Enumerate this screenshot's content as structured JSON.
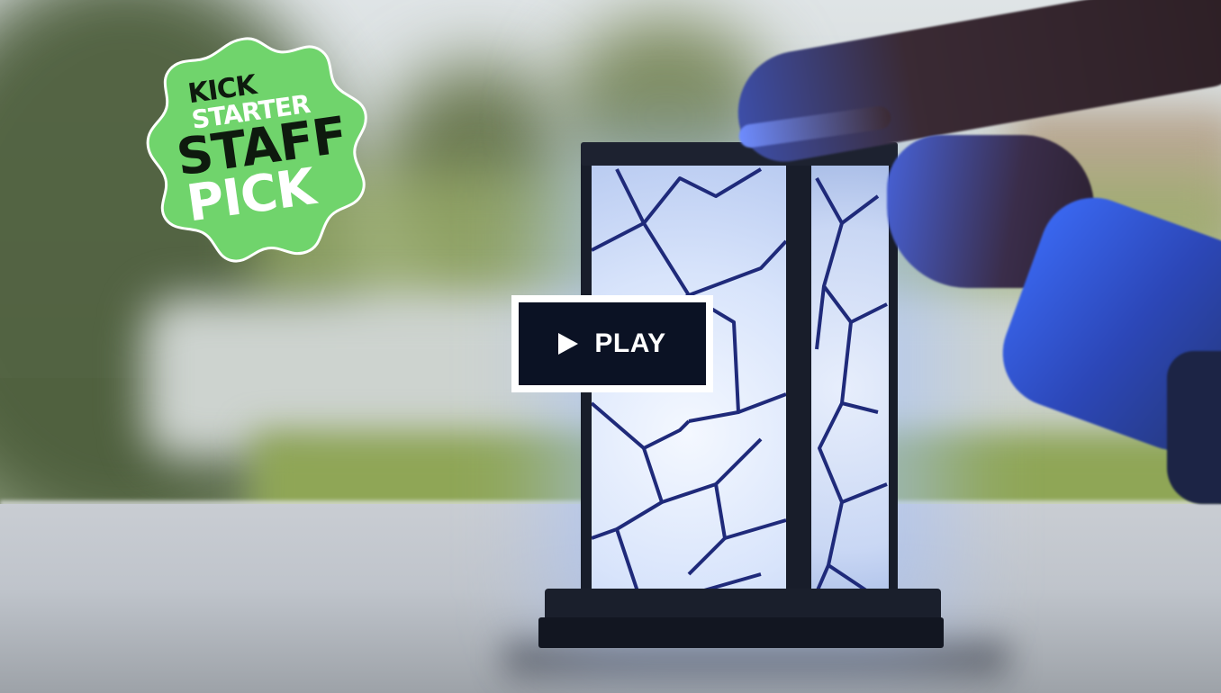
{
  "badge": {
    "line1": "KICK",
    "line2": "STARTER",
    "line3": "STAFF",
    "line4": "PICK",
    "color": "#70d46c"
  },
  "video": {
    "play_label": "PLAY",
    "play_icon": "play-triangle-icon",
    "button_bg": "#0b1224",
    "button_border": "#ffffff"
  }
}
